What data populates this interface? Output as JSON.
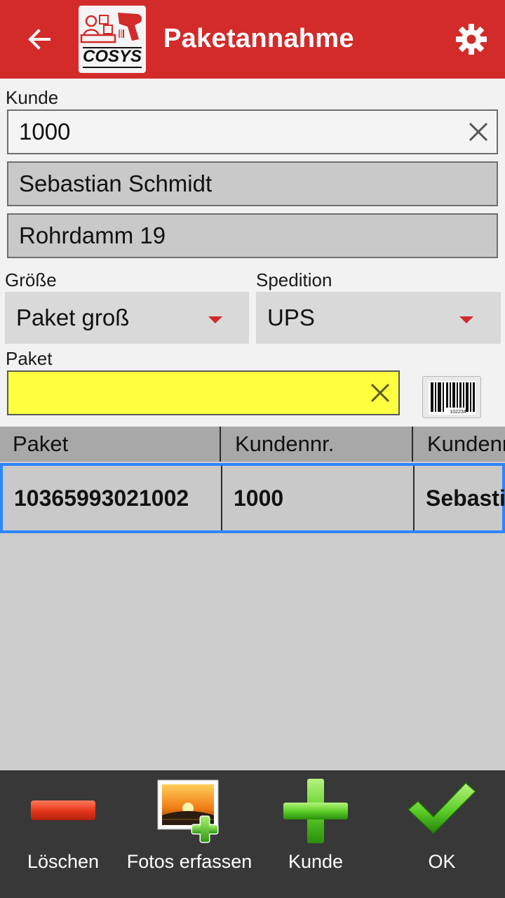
{
  "appbar": {
    "title": "Paketannahme",
    "logo_text": "COSYS",
    "back_icon": "arrow-back-icon",
    "settings_icon": "gear-icon",
    "color": "#d32a2a"
  },
  "kunde": {
    "label": "Kunde",
    "value": "1000",
    "name": "Sebastian Schmidt",
    "address": "Rohrdamm 19"
  },
  "groesse": {
    "label": "Größe",
    "selected": "Paket groß"
  },
  "spedition": {
    "label": "Spedition",
    "selected": "UPS"
  },
  "paket": {
    "label": "Paket",
    "value": "",
    "highlight_color": "#ffff40",
    "barcode_number": "102234"
  },
  "table": {
    "headers": [
      "Paket",
      "Kundennr.",
      "Kundenname"
    ],
    "rows": [
      {
        "paket": "10365993021002",
        "kundennr": "1000",
        "kundenname": "Sebastian Schmidt"
      }
    ],
    "selected_border_color": "#2e86ff"
  },
  "bottombar": {
    "buttons": [
      {
        "label": "Löschen",
        "icon": "minus-icon"
      },
      {
        "label": "Fotos erfassen",
        "icon": "add-photo-icon"
      },
      {
        "label": "Kunde",
        "icon": "plus-icon"
      },
      {
        "label": "OK",
        "icon": "checkmark-icon"
      }
    ]
  }
}
